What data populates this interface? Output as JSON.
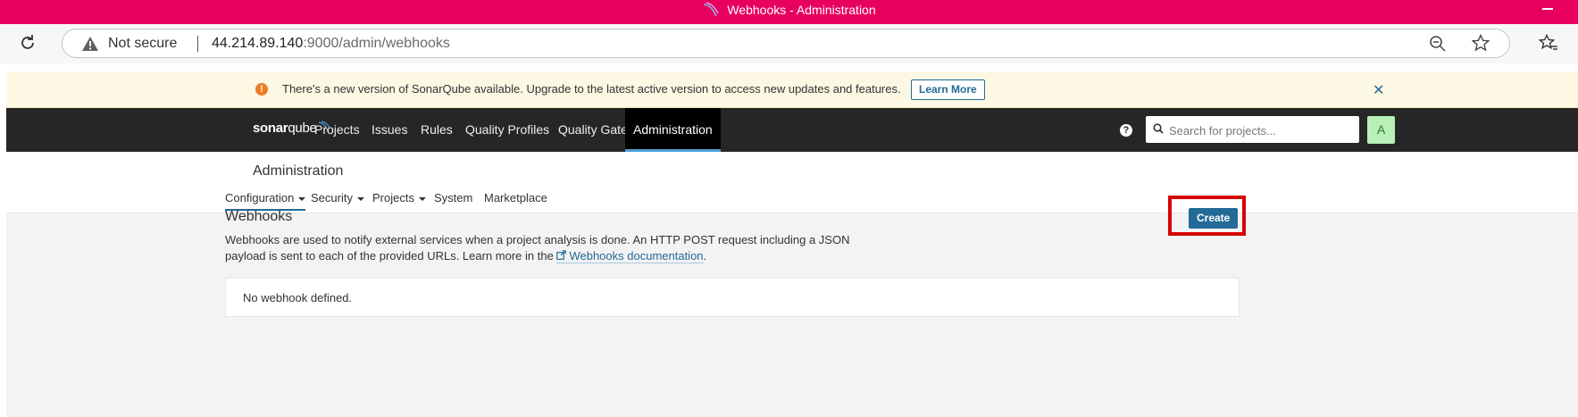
{
  "window": {
    "title": "Webhooks - Administration"
  },
  "browser": {
    "security_label": "Not secure",
    "url_host": "44.214.89.140",
    "url_rest": ":9000/admin/webhooks"
  },
  "banner": {
    "message": "There's a new version of SonarQube available. Upgrade to the latest active version to access new updates and features.",
    "learn_more": "Learn More"
  },
  "nav": {
    "logo_a": "sonar",
    "logo_b": "qube",
    "items": [
      "Projects",
      "Issues",
      "Rules",
      "Quality Profiles",
      "Quality Gates",
      "Administration"
    ],
    "search_placeholder": "Search for projects...",
    "avatar": "A"
  },
  "admin": {
    "title": "Administration",
    "tabs": [
      "Configuration",
      "Security",
      "Projects",
      "System",
      "Marketplace"
    ]
  },
  "webhooks": {
    "title": "Webhooks",
    "description": "Webhooks are used to notify external services when a project analysis is done. An HTTP POST request including a JSON payload is sent to each of the provided URLs. Learn more in the",
    "doc_link": "Webhooks documentation",
    "period": ".",
    "create": "Create",
    "empty": "No webhook defined."
  },
  "colors": {
    "titlebar": "#e8005f",
    "nav": "#262626",
    "primary": "#236a97",
    "highlight": "#d80000"
  }
}
